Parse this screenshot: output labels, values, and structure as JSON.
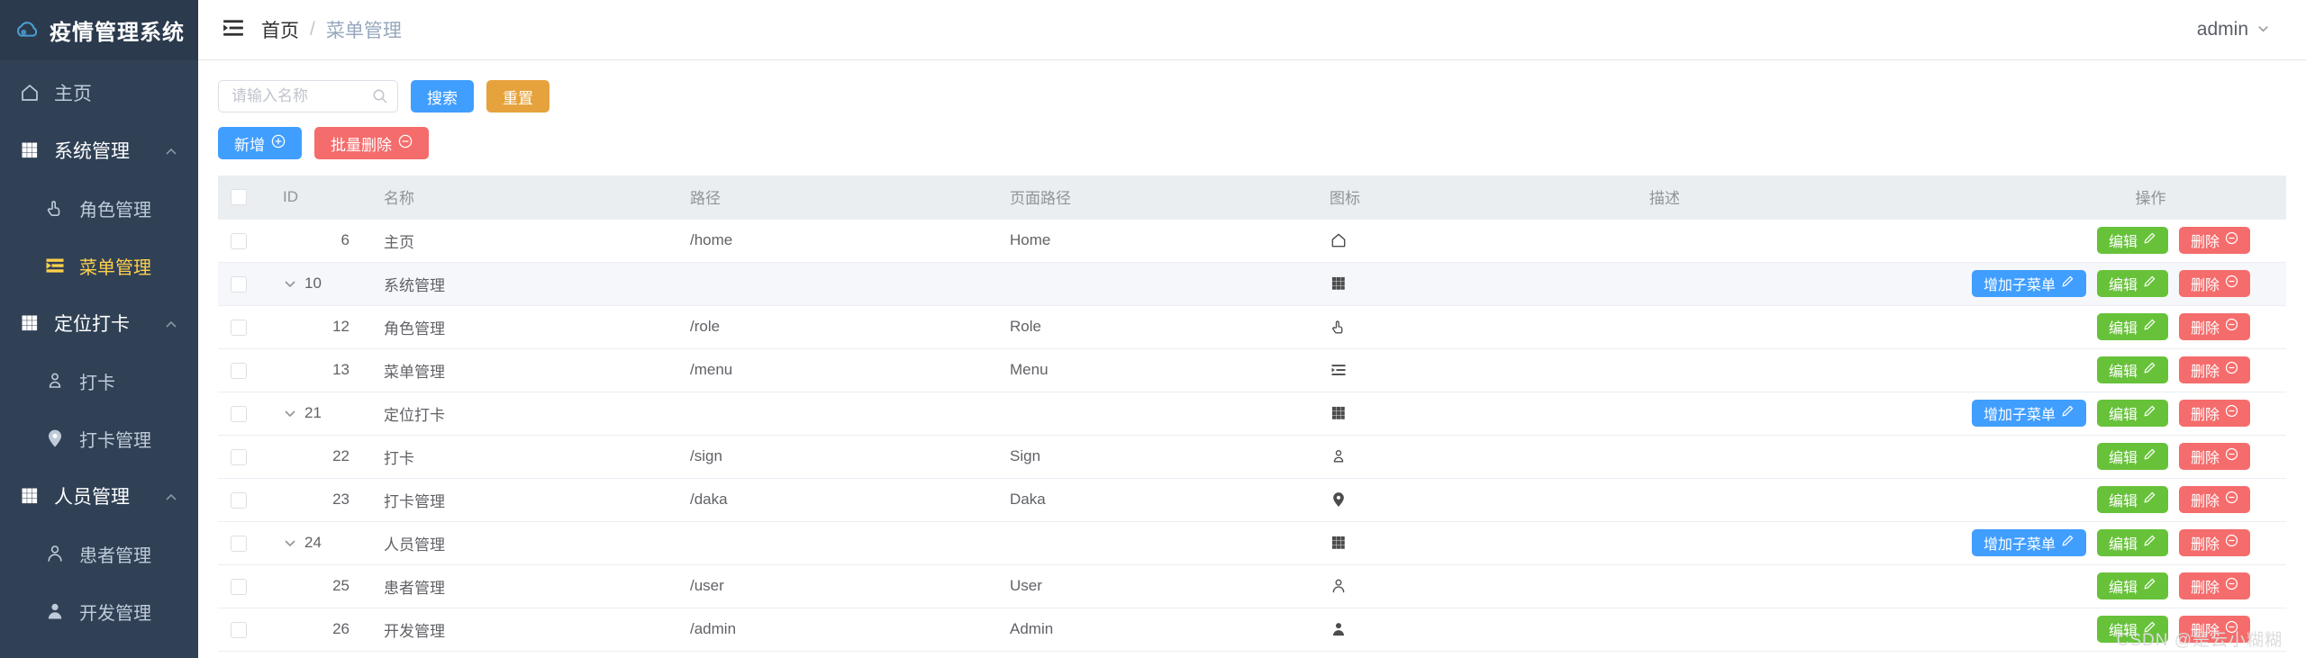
{
  "sidebar": {
    "logo_text": "疫情管理系统",
    "logo_icon": "cloud-icon",
    "items": [
      {
        "label": "主页",
        "icon": "home-icon",
        "level": "top",
        "active": false,
        "caret": ""
      },
      {
        "label": "系统管理",
        "icon": "grid-icon",
        "level": "group",
        "active": false,
        "caret": "chevron-up-icon"
      },
      {
        "label": "角色管理",
        "icon": "pointer-icon",
        "level": "sub",
        "active": false,
        "caret": ""
      },
      {
        "label": "菜单管理",
        "icon": "menu-fold-icon",
        "level": "sub",
        "active": true,
        "caret": ""
      },
      {
        "label": "定位打卡",
        "icon": "grid-icon",
        "level": "group",
        "active": false,
        "caret": "chevron-up-icon"
      },
      {
        "label": "打卡",
        "icon": "user-loc-icon",
        "level": "sub",
        "active": false,
        "caret": ""
      },
      {
        "label": "打卡管理",
        "icon": "location-pin-icon",
        "level": "sub",
        "active": false,
        "caret": ""
      },
      {
        "label": "人员管理",
        "icon": "grid-icon",
        "level": "group",
        "active": false,
        "caret": "chevron-up-icon"
      },
      {
        "label": "患者管理",
        "icon": "user-outline-icon",
        "level": "sub",
        "active": false,
        "caret": ""
      },
      {
        "label": "开发管理",
        "icon": "user-solid-icon",
        "level": "sub",
        "active": false,
        "caret": ""
      }
    ]
  },
  "topbar": {
    "hamburger_icon": "menu-fold-icon",
    "breadcrumb": [
      "首页",
      "菜单管理"
    ],
    "breadcrumb_sep": "/",
    "user_name": "admin",
    "user_caret_icon": "chevron-down-icon"
  },
  "toolbar": {
    "search_placeholder": "请输入名称",
    "search_value": "",
    "search_icon": "search-icon",
    "search_label": "搜索",
    "reset_label": "重置",
    "add_label": "新增",
    "add_icon": "plus-circle-icon",
    "batch_delete_label": "批量删除",
    "batch_delete_icon": "minus-circle-icon"
  },
  "table": {
    "headers": [
      "",
      "ID",
      "名称",
      "路径",
      "页面路径",
      "图标",
      "描述",
      "操作"
    ],
    "op_labels": {
      "add_sub": "增加子菜单",
      "edit": "编辑",
      "delete": "删除",
      "edit_icon": "pencil-icon",
      "delete_icon": "minus-circle-icon",
      "add_sub_icon": "pencil-icon"
    },
    "rows": [
      {
        "id": "6",
        "name": "主页",
        "path": "/home",
        "page": "Home",
        "icon": "home-icon",
        "desc": "",
        "expandable": false,
        "alt": false,
        "has_add_sub": false
      },
      {
        "id": "10",
        "name": "系统管理",
        "path": "",
        "page": "",
        "icon": "grid-icon",
        "desc": "",
        "expandable": true,
        "alt": true,
        "has_add_sub": true
      },
      {
        "id": "12",
        "name": "角色管理",
        "path": "/role",
        "page": "Role",
        "icon": "pointer-icon",
        "desc": "",
        "expandable": false,
        "alt": false,
        "has_add_sub": false
      },
      {
        "id": "13",
        "name": "菜单管理",
        "path": "/menu",
        "page": "Menu",
        "icon": "menu-fold-icon",
        "desc": "",
        "expandable": false,
        "alt": false,
        "has_add_sub": false
      },
      {
        "id": "21",
        "name": "定位打卡",
        "path": "",
        "page": "",
        "icon": "grid-icon",
        "desc": "",
        "expandable": true,
        "alt": false,
        "has_add_sub": true
      },
      {
        "id": "22",
        "name": "打卡",
        "path": "/sign",
        "page": "Sign",
        "icon": "user-loc-icon",
        "desc": "",
        "expandable": false,
        "alt": false,
        "has_add_sub": false
      },
      {
        "id": "23",
        "name": "打卡管理",
        "path": "/daka",
        "page": "Daka",
        "icon": "location-pin-icon",
        "desc": "",
        "expandable": false,
        "alt": false,
        "has_add_sub": false
      },
      {
        "id": "24",
        "name": "人员管理",
        "path": "",
        "page": "",
        "icon": "grid-icon",
        "desc": "",
        "expandable": true,
        "alt": false,
        "has_add_sub": true
      },
      {
        "id": "25",
        "name": "患者管理",
        "path": "/user",
        "page": "User",
        "icon": "user-outline-icon",
        "desc": "",
        "expandable": false,
        "alt": false,
        "has_add_sub": false
      },
      {
        "id": "26",
        "name": "开发管理",
        "path": "/admin",
        "page": "Admin",
        "icon": "user-solid-icon",
        "desc": "",
        "expandable": false,
        "alt": false,
        "has_add_sub": false
      }
    ]
  },
  "watermark": "CSDN @是云小糊糊",
  "colors": {
    "sidebar_bg": "#304156",
    "active_yellow": "#ffd04b",
    "primary_blue": "#409eff",
    "warning_orange": "#e6a23c",
    "danger_red": "#f56c6c",
    "success_green": "#67c23a",
    "header_gray": "#ebeef0"
  }
}
